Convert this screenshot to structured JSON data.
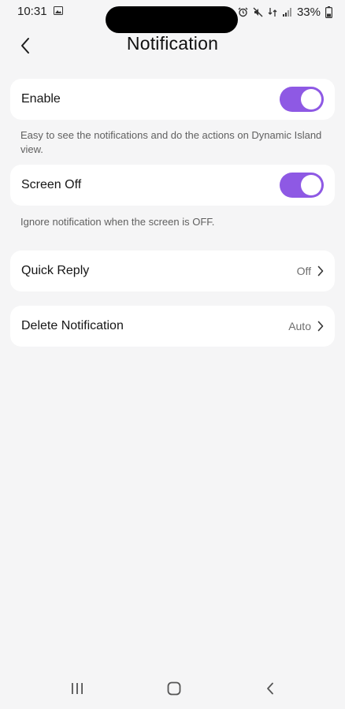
{
  "status_bar": {
    "time": "10:31",
    "battery": "33%"
  },
  "header": {
    "title": "Notification"
  },
  "settings": {
    "enable": {
      "label": "Enable",
      "on": true,
      "description": "Easy to see the notifications and do the actions on Dynamic Island view."
    },
    "screen_off": {
      "label": "Screen Off",
      "on": true,
      "description": "Ignore notification when the screen is OFF."
    },
    "quick_reply": {
      "label": "Quick Reply",
      "value": "Off"
    },
    "delete_notification": {
      "label": "Delete Notification",
      "value": "Auto"
    }
  },
  "colors": {
    "accent": "#8e59e4",
    "background": "#f5f5f6",
    "card": "#ffffff"
  },
  "icons": {
    "back": "chevron-left-icon",
    "row_chevron": "chevron-right-icon",
    "nav_recents": "recents-icon",
    "nav_home": "home-icon",
    "nav_back": "back-icon"
  }
}
